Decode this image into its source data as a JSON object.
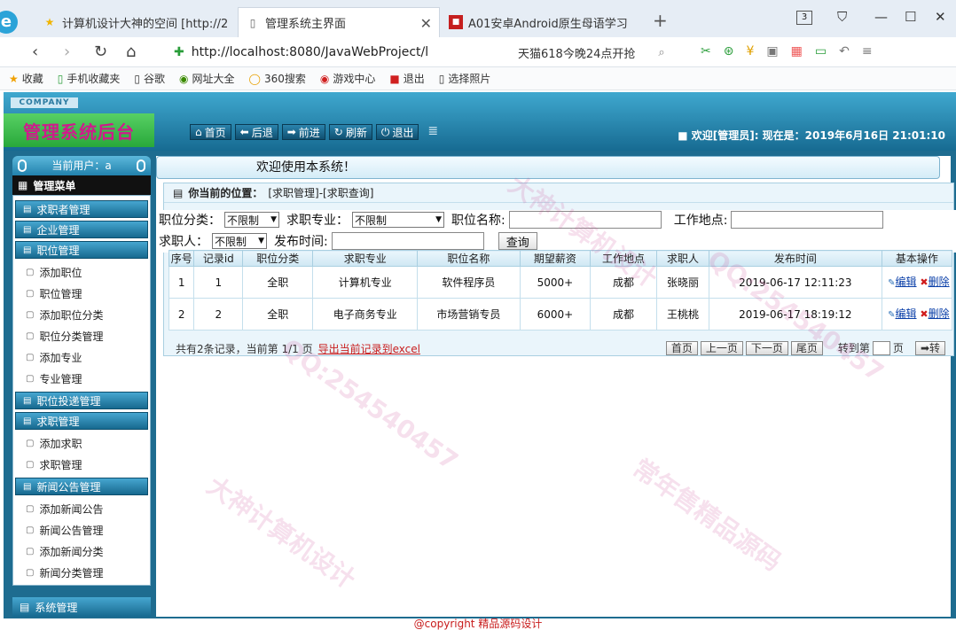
{
  "browser": {
    "tabs": [
      {
        "title": "计算机设计大神的空间 [http://2",
        "icon": "star-icon"
      },
      {
        "title": "管理系统主界面",
        "icon": "page-icon"
      },
      {
        "title": "A01安卓Android原生母语学习",
        "icon": "app-icon"
      }
    ],
    "tab_count": "3",
    "url": "http://localhost:8080/JavaWebProject/l",
    "search_text": "天猫618今晚24点开抢"
  },
  "bookmarks": [
    "收藏",
    "手机收藏夹",
    "谷歌",
    "网址大全",
    "360搜索",
    "游戏中心",
    "退出",
    "选择照片"
  ],
  "header": {
    "company": "COMPANY",
    "brand": "管理系统后台",
    "nav": [
      "首页",
      "后退",
      "前进",
      "刷新",
      "退出"
    ],
    "welcome": "■ 欢迎[管理员]:  现在是：2019年6月16日 21:01:10"
  },
  "left": {
    "current_user": "当前用户：a",
    "menu_title": "管理菜单",
    "groups": [
      {
        "label": "求职者管理",
        "items": []
      },
      {
        "label": "企业管理",
        "items": []
      },
      {
        "label": "职位管理",
        "items": [
          "添加职位",
          "职位管理",
          "添加职位分类",
          "职位分类管理",
          "添加专业",
          "专业管理"
        ]
      },
      {
        "label": "职位投递管理",
        "items": []
      },
      {
        "label": "求职管理",
        "items": [
          "添加求职",
          "求职管理"
        ]
      },
      {
        "label": "新闻公告管理",
        "items": [
          "添加新闻公告",
          "新闻公告管理",
          "添加新闻分类",
          "新闻分类管理"
        ]
      }
    ],
    "system": "系统管理"
  },
  "main": {
    "welcome": "欢迎使用本系统！",
    "crumb_label": "你当前的位置：",
    "crumb_path": "[求职管理]-[求职查询]",
    "filter": {
      "category_label": "职位分类：",
      "category_value": "不限制",
      "major_label": "求职专业：",
      "major_value": "不限制",
      "name_label": "职位名称:",
      "place_label": "工作地点:",
      "person_label": "求职人：",
      "person_value": "不限制",
      "time_label": "发布时间:",
      "query_button": "查询"
    },
    "table": {
      "headers": [
        "序号",
        "记录id",
        "职位分类",
        "求职专业",
        "职位名称",
        "期望薪资",
        "工作地点",
        "求职人",
        "发布时间",
        "基本操作"
      ],
      "rows": [
        [
          "1",
          "1",
          "全职",
          "计算机专业",
          "软件程序员",
          "5000+",
          "成都",
          "张晓丽",
          "2019-06-17 12:11:23"
        ],
        [
          "2",
          "2",
          "全职",
          "电子商务专业",
          "市场营销专员",
          "6000+",
          "成都",
          "王桃桃",
          "2019-06-17 18:19:12"
        ]
      ],
      "op_edit": "编辑",
      "op_delete": "删除"
    },
    "pager": {
      "summary": "共有2条记录，当前第 1/1 页",
      "export": "导出当前记录到excel",
      "first": "首页",
      "prev": "上一页",
      "next": "下一页",
      "last": "尾页",
      "goto_label": "转到第",
      "page_label": "页",
      "go": "➡转"
    }
  },
  "footer": "@copyright 精品源码设计",
  "watermarks": [
    "QQ:254540457",
    "大神计算机设计",
    "常年售精品源码"
  ]
}
